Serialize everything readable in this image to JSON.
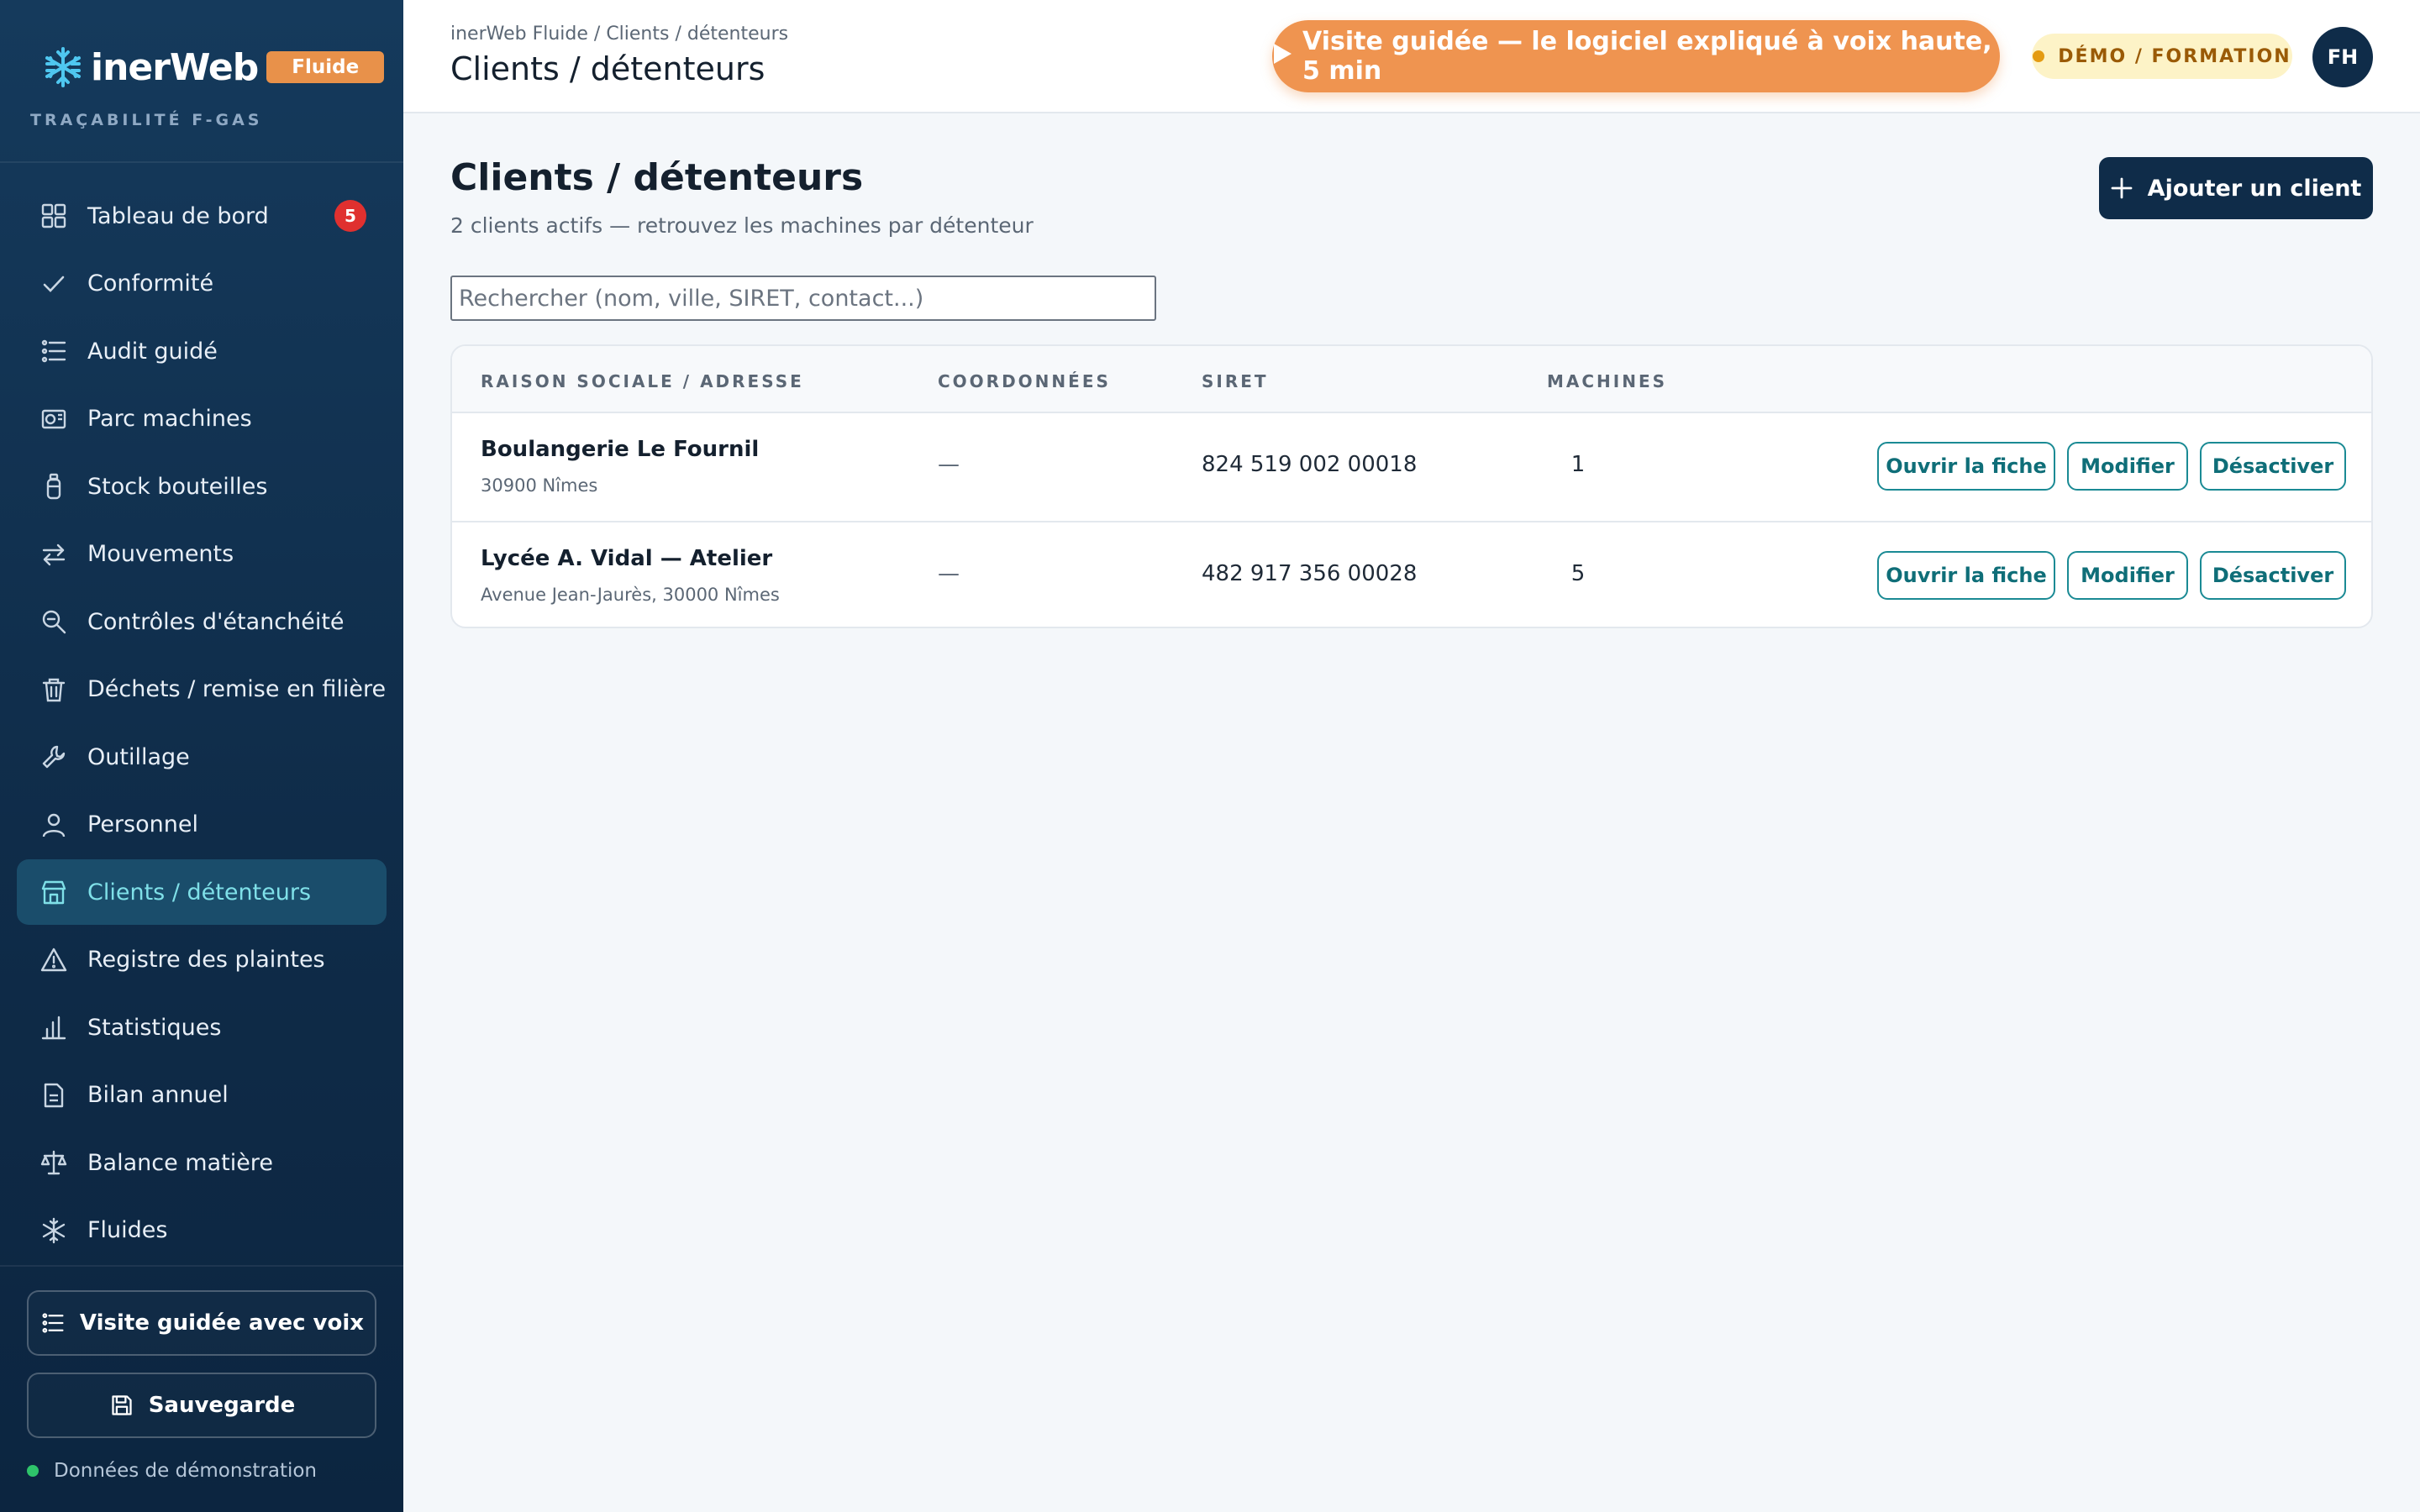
{
  "brand": {
    "name_a": "inerWeb",
    "name_b": "",
    "badge": "Fluide",
    "subtitle": "TRAÇABILITÉ F-GAS"
  },
  "sidebar": {
    "items": [
      {
        "label": "Tableau de bord",
        "icon": "dashboard-grid-icon",
        "badge": "5"
      },
      {
        "label": "Conformité",
        "icon": "check-icon"
      },
      {
        "label": "Audit guidé",
        "icon": "list-icon"
      },
      {
        "label": "Parc machines",
        "icon": "machine-icon"
      },
      {
        "label": "Stock bouteilles",
        "icon": "bottle-icon"
      },
      {
        "label": "Mouvements",
        "icon": "swap-arrows-icon"
      },
      {
        "label": "Contrôles d'étanchéité",
        "icon": "zoom-search-icon"
      },
      {
        "label": "Déchets / remise en filière",
        "icon": "trash-icon"
      },
      {
        "label": "Outillage",
        "icon": "wrench-icon"
      },
      {
        "label": "Personnel",
        "icon": "person-icon"
      },
      {
        "label": "Clients / détenteurs",
        "icon": "store-icon",
        "active": true
      },
      {
        "label": "Registre des plaintes",
        "icon": "warning-icon"
      },
      {
        "label": "Statistiques",
        "icon": "bar-chart-icon"
      },
      {
        "label": "Bilan annuel",
        "icon": "document-icon"
      },
      {
        "label": "Balance matière",
        "icon": "scale-icon"
      },
      {
        "label": "Fluides",
        "icon": "snowflake-icon"
      }
    ],
    "tour_button": "Visite guidée avec voix",
    "save_button": "Sauvegarde",
    "demo_status": "Données de démonstration"
  },
  "topbar": {
    "breadcrumb": "inerWeb Fluide / Clients / détenteurs",
    "title": "Clients / détenteurs",
    "tour_button": "Visite guidée — le logiciel expliqué à voix haute, 5 min",
    "demo_badge": "DÉMO / FORMATION",
    "avatar_initials": "FH"
  },
  "main": {
    "title": "Clients / détenteurs",
    "subtitle": "2 clients actifs — retrouvez les machines par détenteur",
    "add_button": "Ajouter un client",
    "search_placeholder": "Rechercher (nom, ville, SIRET, contact...)",
    "table": {
      "headers": [
        "RAISON SOCIALE / ADRESSE",
        "COORDONNÉES",
        "SIRET",
        "MACHINES"
      ],
      "rows": [
        {
          "name": "Boulangerie Le Fournil",
          "address": "30900 Nîmes",
          "coords": "—",
          "siret": "824 519 002 00018",
          "machines": "1"
        },
        {
          "name": "Lycée A. Vidal — Atelier",
          "address": "Avenue Jean-Jaurès, 30000 Nîmes",
          "coords": "—",
          "siret": "482 917 356 00028",
          "machines": "5"
        }
      ],
      "actions": {
        "open": "Ouvrir la fiche",
        "edit": "Modifier",
        "deactivate": "Désactiver"
      }
    }
  },
  "colors": {
    "sidebar": "#0f2c49",
    "accent_orange": "#ef9450",
    "teal": "#1a8a94",
    "active_text": "#7fe0e8",
    "badge_red": "#e0302f",
    "status_green": "#2ec46a"
  }
}
